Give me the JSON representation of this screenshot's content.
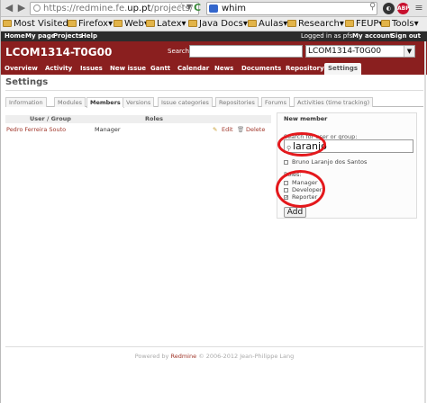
{
  "browser": {
    "url_prefix": "https://redmine.fe.",
    "url_domain": "up.pt",
    "url_suffix": "/projects/",
    "search_value": "whim",
    "abp_label": "ABP",
    "bookmarks": [
      "Most Visited",
      "Firefox",
      "Web",
      "Latex",
      "Java Docs",
      "Aulas",
      "Research",
      "FEUP",
      "Tools"
    ]
  },
  "top_menu": {
    "items": [
      "Home",
      "My page",
      "Projects",
      "Help"
    ],
    "logged_in": "Logged in as pfs",
    "my_account": "My account",
    "sign_out": "Sign out"
  },
  "header": {
    "project_title": "LCOM1314-T0G00",
    "search_label": "Search:",
    "project_select": "LCOM1314-T0G00",
    "tabs": [
      "Overview",
      "Activity",
      "Issues",
      "New issue",
      "Gantt",
      "Calendar",
      "News",
      "Documents",
      "Repository",
      "Settings"
    ]
  },
  "settings": {
    "title": "Settings",
    "subtabs": [
      "Information",
      "Modules",
      "Members",
      "Versions",
      "Issue categories",
      "Repositories",
      "Forums",
      "Activities (time tracking)"
    ],
    "members_table": {
      "columns": [
        "User / Group",
        "Roles"
      ],
      "rows": [
        {
          "user": "Pedro Ferreira Souto",
          "role": "Manager",
          "edit": "Edit",
          "delete": "Delete"
        }
      ]
    },
    "new_member": {
      "title": "New member",
      "search_label": "Search for user or group:",
      "search_value": "laranjo",
      "candidate": "Bruno Laranjo dos Santos",
      "roles_label": "Roles:",
      "roles": [
        "Manager",
        "Developer",
        "Reporter"
      ],
      "add_button": "Add"
    }
  },
  "footer": {
    "powered_by": "Powered by",
    "redmine": "Redmine",
    "copyright": "© 2006-2012 Jean-Philippe Lang"
  },
  "colors": {
    "header": "#8a1f1f",
    "top_menu": "#2c2c2c",
    "annotation": "#e4181c"
  }
}
